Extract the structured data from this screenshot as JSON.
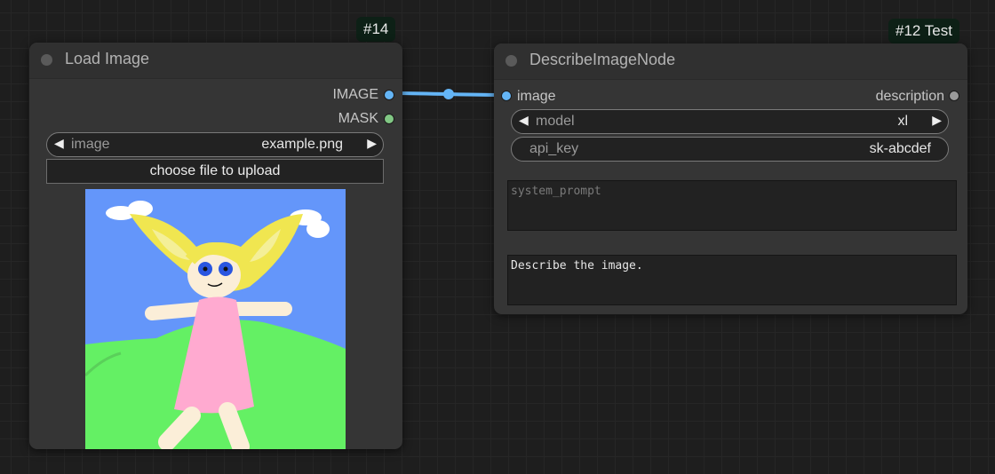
{
  "load_node": {
    "badge": "#14",
    "title": "Load Image",
    "outputs": [
      "IMAGE",
      "MASK"
    ],
    "image_combo": {
      "label": "image",
      "value": "example.png"
    },
    "upload_label": "choose file to upload"
  },
  "describe_node": {
    "badge": "#12 Test",
    "title": "DescribeImageNode",
    "input": "image",
    "output": "description",
    "model_combo": {
      "label": "model",
      "value": "xl"
    },
    "api_key": {
      "label": "api_key",
      "value": "sk-abcdef"
    },
    "system_prompt_placeholder": "system_prompt",
    "prompt_value": "Describe the image."
  },
  "colors": {
    "image_slot": "#64b5f6",
    "mask_slot": "#81c784",
    "link": "#64b5f6",
    "description_slot": "#9a9a9a"
  }
}
